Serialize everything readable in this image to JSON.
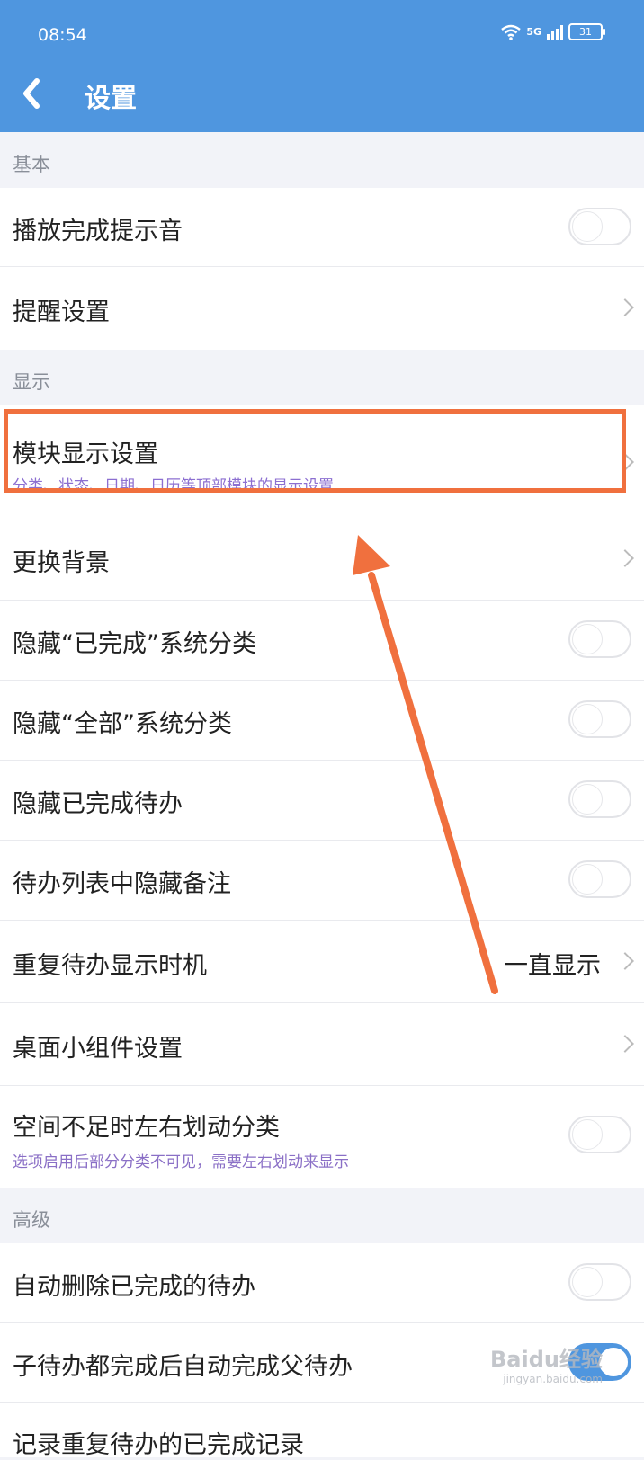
{
  "status_bar": {
    "time": "08:54",
    "network": "5G",
    "battery": "31"
  },
  "header": {
    "back_icon": "chevron-left-icon",
    "title": "设置"
  },
  "sections": {
    "basic": "基本",
    "display": "显示",
    "advanced": "高级"
  },
  "rows": {
    "play_sound": {
      "label": "播放完成提示音",
      "toggle": false
    },
    "reminder": {
      "label": "提醒设置"
    },
    "module_display": {
      "label": "模块显示设置",
      "sub": "分类、状态、日期、日历等顶部模块的显示设置"
    },
    "background": {
      "label": "更换背景"
    },
    "hide_done_category": {
      "label": "隐藏“已完成”系统分类",
      "toggle": false
    },
    "hide_all_category": {
      "label": "隐藏“全部”系统分类",
      "toggle": false
    },
    "hide_done_todo": {
      "label": "隐藏已完成待办",
      "toggle": false
    },
    "hide_notes": {
      "label": "待办列表中隐藏备注",
      "toggle": false
    },
    "repeat_display": {
      "label": "重复待办显示时机",
      "value": "一直显示"
    },
    "widget": {
      "label": "桌面小组件设置"
    },
    "swipe_category": {
      "label": "空间不足时左右划动分类",
      "sub": "选项启用后部分分类不可见，需要左右划动来显示",
      "toggle": false
    },
    "auto_delete": {
      "label": "自动删除已完成的待办",
      "toggle": false
    },
    "auto_complete_parent": {
      "label": "子待办都完成后自动完成父待办",
      "toggle": true
    },
    "record_repeat": {
      "label": "记录重复待办的已完成记录"
    }
  },
  "colors": {
    "accent": "#4f96df",
    "annotation": "#f0703e"
  },
  "watermark": {
    "text": "Baidu经验",
    "sub": "jingyan.baidu.com"
  }
}
